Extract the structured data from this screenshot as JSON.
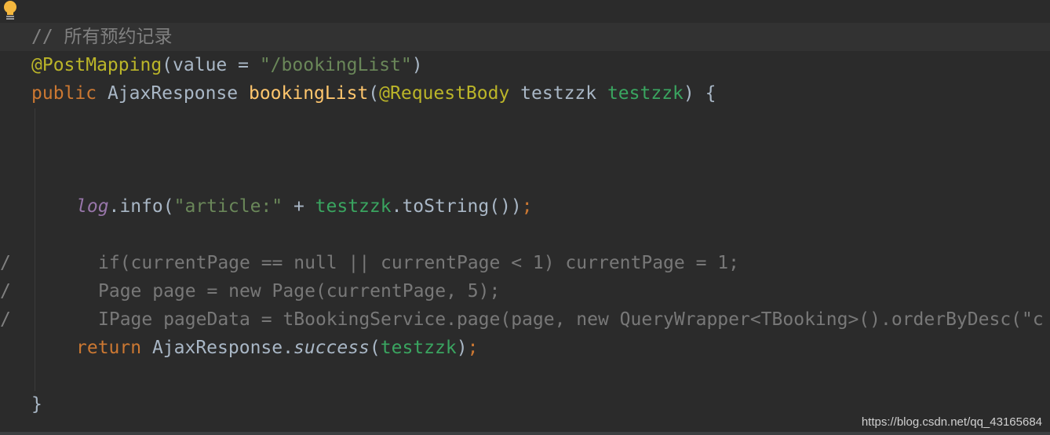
{
  "editor": {
    "intention_icon": "lightbulb-icon",
    "lines": {
      "comment": "// 所有预约记录",
      "annotation": {
        "name": "@PostMapping",
        "open": "(",
        "param": "value",
        "eq": " = ",
        "value": "\"/bookingList\"",
        "close": ")"
      },
      "signature": {
        "modifier": "public",
        "return_type": " AjaxResponse ",
        "method": "bookingList",
        "open": "(",
        "param_annotation": "@RequestBody",
        "param_type": " testzzk ",
        "param_name": "testzzk",
        "close": ") {"
      },
      "log_call": {
        "field": "log",
        "dot_info": ".info(",
        "string": "\"article:\"",
        "plus": " + ",
        "var": "testzzk",
        "rest": ".toString())",
        "semicolon": ";"
      },
      "commented_1": {
        "marker": "/",
        "code": "if(currentPage == null || currentPage < 1) currentPage = 1;"
      },
      "commented_2": {
        "marker": "/",
        "code": "Page page = new Page(currentPage, 5);"
      },
      "commented_3": {
        "marker": "/",
        "code": "IPage pageData = tBookingService.page(page, new QueryWrapper<TBooking>().orderByDesc(\"c"
      },
      "return_line": {
        "keyword": "return",
        "type": " AjaxResponse.",
        "method": "success",
        "open": "(",
        "var": "testzzk",
        "close": ")",
        "semicolon": ";"
      },
      "closing_brace": "}"
    }
  },
  "watermark": "https://blog.csdn.net/qq_43165684"
}
